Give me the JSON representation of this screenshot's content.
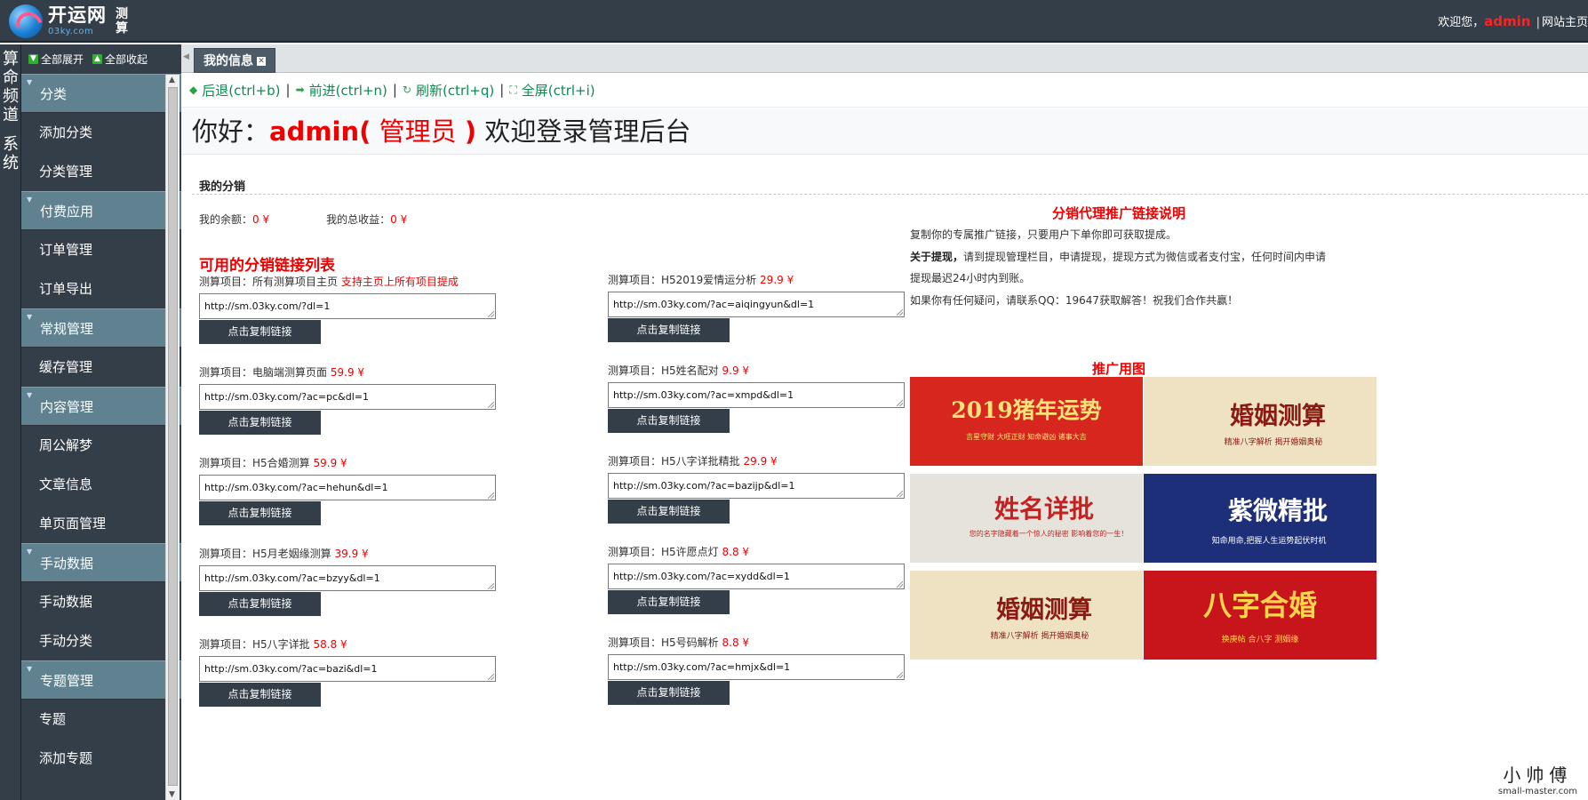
{
  "header": {
    "logo_name": "开运网",
    "logo_domain": "03ky.com",
    "logo_sub": "测算",
    "welcome_prefix": "欢迎您，",
    "username": "admin",
    "site_home": "网站主页"
  },
  "vertical_tabs": [
    {
      "label": "算命频道"
    },
    {
      "label": "系统"
    }
  ],
  "sidebar": {
    "expand_all": "全部展开",
    "collapse_all": "全部收起",
    "groups": [
      {
        "title": "分类",
        "items": [
          "添加分类",
          "分类管理"
        ]
      },
      {
        "title": "付费应用",
        "items": [
          "订单管理",
          "订单导出"
        ]
      },
      {
        "title": "常规管理",
        "items": [
          "缓存管理"
        ]
      },
      {
        "title": "内容管理",
        "items": [
          "周公解梦",
          "文章信息",
          "单页面管理"
        ]
      },
      {
        "title": "手动数据",
        "items": [
          "手动数据",
          "手动分类"
        ]
      },
      {
        "title": "专题管理",
        "items": [
          "专题",
          "添加专题"
        ]
      }
    ]
  },
  "tabs": {
    "active": "我的信息"
  },
  "toolbar": {
    "back": "后退(ctrl+b)",
    "forward": "前进(ctrl+n)",
    "refresh": "刷新(ctrl+q)",
    "fullscreen": "全屏(ctrl+i)",
    "separator": "|"
  },
  "greeting": {
    "hello": "你好：",
    "admin": "admin(",
    "role": " 管理员 ",
    "close": ")",
    "text": " 欢迎登录管理后台"
  },
  "distribution": {
    "title": "我的分销",
    "balance_label": "我的余额：",
    "balance_value": "0 ¥",
    "income_label": "我的总收益：",
    "income_value": "0 ¥",
    "list_title": "可用的分销链接列表",
    "item_prefix": "测算项目：",
    "copy_button": "点击复制链接",
    "links": [
      {
        "name": "所有测算项目主页",
        "price": "",
        "hint": "支持主页上所有项目提成",
        "url": "http://sm.03ky.com/?dl=1"
      },
      {
        "name": "H52019爱情运分析",
        "price": "29.9 ¥",
        "hint": "",
        "url": "http://sm.03ky.com/?ac=aiqingyun&dl=1"
      },
      {
        "name": "电脑端测算页面",
        "price": "59.9 ¥",
        "hint": "",
        "url": "http://sm.03ky.com/?ac=pc&dl=1"
      },
      {
        "name": "H5姓名配对",
        "price": "9.9 ¥",
        "hint": "",
        "url": "http://sm.03ky.com/?ac=xmpd&dl=1"
      },
      {
        "name": "H5合婚测算",
        "price": "59.9 ¥",
        "hint": "",
        "url": "http://sm.03ky.com/?ac=hehun&dl=1"
      },
      {
        "name": "H5八字详批精批",
        "price": "29.9 ¥",
        "hint": "",
        "url": "http://sm.03ky.com/?ac=bazijp&dl=1"
      },
      {
        "name": "H5月老姻缘测算",
        "price": "39.9 ¥",
        "hint": "",
        "url": "http://sm.03ky.com/?ac=bzyy&dl=1"
      },
      {
        "name": "H5许愿点灯",
        "price": "8.8 ¥",
        "hint": "",
        "url": "http://sm.03ky.com/?ac=xydd&dl=1"
      },
      {
        "name": "H5八字详批",
        "price": "58.8 ¥",
        "hint": "",
        "url": "http://sm.03ky.com/?ac=bazi&dl=1"
      },
      {
        "name": "H5号码解析",
        "price": "8.8 ¥",
        "hint": "",
        "url": "http://sm.03ky.com/?ac=hmjx&dl=1"
      }
    ]
  },
  "explanation": {
    "title": "分销代理推广链接说明",
    "p1": "复制你的专属推广链接，只要用户下单你即可获取提成。",
    "p2_bold": "关于提现，",
    "p2": "请到提现管理栏目，申请提现，提现方式为微信或者支付宝，任何时间内申请提现最迟24小时内到账。",
    "p3": "如果你有任何疑问，请联系QQ：19647获取解答！祝我们合作共赢！"
  },
  "promo": {
    "title": "推广用图",
    "banners": [
      {
        "main": "2019猪年运势",
        "sub": "吉星守财  大旺正财  知命避凶  诸事大吉",
        "bg": "#d6261e",
        "fg": "#ffe27a"
      },
      {
        "main": "婚姻测算",
        "sub": "精准八字解析  揭开婚姻奥秘",
        "bg": "#efe2c2",
        "fg": "#8a1a12"
      },
      {
        "main": "姓名详批",
        "sub": "您的名字隐藏着一个惊人的秘密 影响着您的一生！",
        "bg": "#e6e3dc",
        "fg": "#c22222"
      },
      {
        "main": "紫微精批",
        "sub": "知命用命,把握人生运势起伏时机",
        "bg": "#1c2f78",
        "fg": "#ffffff"
      },
      {
        "main": "婚姻测算",
        "sub": "精准八字解析  揭开婚姻奥秘",
        "bg": "#efe2c2",
        "fg": "#8a1a12"
      },
      {
        "main": "八字合婚",
        "sub": "换庚帖  合八字  测姻缘",
        "bg": "#c8151b",
        "fg": "#ffd54a"
      }
    ]
  },
  "watermark": {
    "cn": "小帅傅",
    "en": "small-master.com"
  },
  "colors": {
    "header_bg": "#343e48",
    "group_bg": "#5f8190",
    "accent_red": "#ee0000",
    "nav_green": "#0f8a52"
  }
}
